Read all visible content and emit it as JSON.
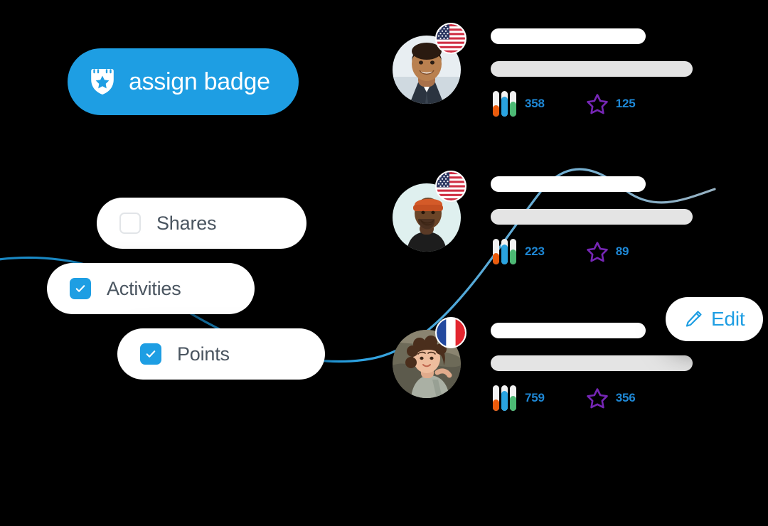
{
  "theme": {
    "background": "#000000",
    "accent_blue": "#1e9ee3",
    "metric_blue": "#1e88d6",
    "star_purple": "#7626b5",
    "label_gray": "#4a5560",
    "bar_gray": "#e4e4e4",
    "bar_white": "#ffffff"
  },
  "assign_badge": {
    "label": "assign badge",
    "icon": "shield-badge-icon"
  },
  "filters": [
    {
      "label": "Shares",
      "checked": false,
      "icon": "checkbox-icon"
    },
    {
      "label": "Activities",
      "checked": true,
      "icon": "checkbox-checked-icon"
    },
    {
      "label": "Points",
      "checked": true,
      "icon": "checkbox-checked-icon"
    }
  ],
  "edit_button": {
    "label": "Edit",
    "icon": "pencil-icon"
  },
  "users": [
    {
      "flag": "us-flag-icon",
      "avatar": "avatar-man-suit",
      "metrics": [
        {
          "icon": "bar-chart-icon",
          "value": "358"
        },
        {
          "icon": "star-icon",
          "value": "125"
        }
      ]
    },
    {
      "flag": "us-flag-icon",
      "avatar": "avatar-man-beanie",
      "metrics": [
        {
          "icon": "bar-chart-icon",
          "value": "223"
        },
        {
          "icon": "star-icon",
          "value": "89"
        }
      ]
    },
    {
      "flag": "fr-flag-icon",
      "avatar": "avatar-woman-curly",
      "metrics": [
        {
          "icon": "bar-chart-icon",
          "value": "759"
        },
        {
          "icon": "star-icon",
          "value": "356"
        }
      ]
    }
  ]
}
